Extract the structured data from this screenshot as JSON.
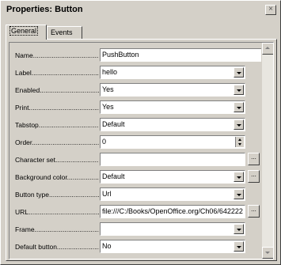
{
  "window": {
    "title": "Properties: Button",
    "close_glyph": "×"
  },
  "tabs": [
    {
      "label": "General",
      "active": true
    },
    {
      "label": "Events",
      "active": false
    }
  ],
  "properties": [
    {
      "label": "Name........................................",
      "value": "PushButton",
      "control": "text"
    },
    {
      "label": "Label........................................",
      "value": "hello",
      "control": "dropdown"
    },
    {
      "label": "Enabled........................................",
      "value": "Yes",
      "control": "dropdown"
    },
    {
      "label": "Print........................................",
      "value": "Yes",
      "control": "dropdown"
    },
    {
      "label": "Tabstop........................................",
      "value": "Default",
      "control": "dropdown"
    },
    {
      "label": "Order........................................",
      "value": "0",
      "control": "spinner"
    },
    {
      "label": "Character set........................................",
      "value": "",
      "control": "ellipsis"
    },
    {
      "label": "Background color........................................",
      "value": "Default",
      "control": "dropdown-ellipsis"
    },
    {
      "label": "Button type........................................",
      "value": "Url",
      "control": "dropdown"
    },
    {
      "label": "URL........................................",
      "value": "file:///C:/Books/OpenOffice.org/Ch06/642222",
      "control": "ellipsis"
    },
    {
      "label": "Frame........................................",
      "value": "",
      "control": "dropdown"
    },
    {
      "label": "Default button........................................",
      "value": "No",
      "control": "dropdown"
    }
  ],
  "ellipsis_glyph": "...",
  "icons": {
    "close": "close-icon",
    "dropdown": "chevron-down-icon",
    "spin": "spinner-arrows-icon",
    "scroll_up": "arrow-up-icon",
    "scroll_down": "arrow-down-icon"
  }
}
